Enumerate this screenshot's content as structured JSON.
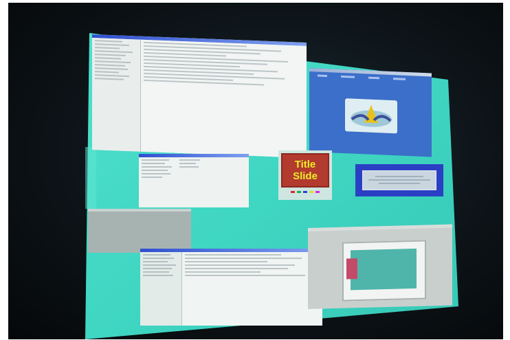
{
  "photo": {
    "subject": "",
    "slide_text": {
      "line1": "Title",
      "line2": "Slide"
    }
  },
  "colors": {
    "wall": "#3fd6c2",
    "room": "#0b1114",
    "window_title": "#2f4fd0",
    "blue_app_bg": "#3c6fc9",
    "slide_red": "#b33a2e",
    "slide_text": "#e8ef2a",
    "dialog_blue": "#2a3fc4"
  },
  "icons": {
    "slide_thumbnail": "title-slide-icon",
    "dolphin_image": "dolphin-image-icon"
  }
}
